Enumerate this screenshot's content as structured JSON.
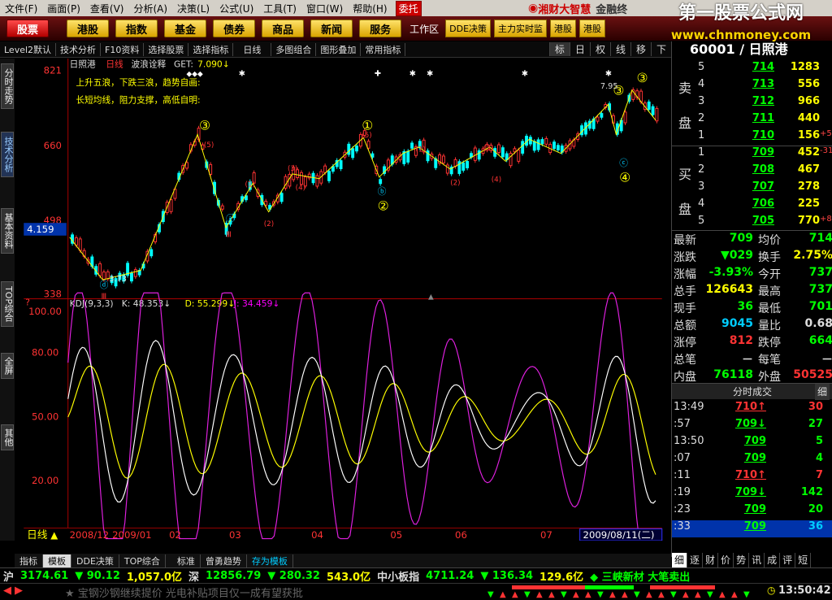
{
  "menu": [
    "文件(F)",
    "画面(P)",
    "查看(V)",
    "分析(A)",
    "决策(L)",
    "公式(U)",
    "工具(T)",
    "窗口(W)",
    "帮助(H)"
  ],
  "menu_red": "委托",
  "logo": {
    "brand": "湘财大智慧",
    "sub": "金融终"
  },
  "watermark": {
    "line1": "第一股票公式网",
    "line2": "www.chnmoney.com"
  },
  "nav": {
    "buttons": [
      "股票",
      "港股",
      "指数",
      "基金",
      "债券",
      "商品",
      "新闻",
      "服务"
    ],
    "workarea": "工作区",
    "right": [
      "DDE决策",
      "主力实时监",
      "港股",
      "港股"
    ]
  },
  "toolbar": {
    "items": [
      "Level2默认",
      "技术分析",
      "F10资料",
      "选择股票",
      "选择指标",
      "日线",
      "多图组合",
      "图形叠加",
      "常用指标"
    ],
    "small": [
      "标",
      "日",
      "权",
      "线",
      "移",
      "下"
    ]
  },
  "sidetabs": [
    "分时走势",
    "技术分析",
    "基本资料",
    "TOP综合",
    "全屏",
    "其他"
  ],
  "chart": {
    "title": "日照港",
    "period": "日线",
    "indicator": "波浪诠释",
    "get_label": "GET:",
    "get_value": "7.090↓",
    "notes": [
      "上升五浪，下跌三浪，趋势自画:",
      "长短均线，阻力支撑，高低自明:"
    ],
    "price_labels": [
      "821",
      "660",
      "498",
      "338"
    ],
    "current_price": "4.159",
    "low_label": "3.73",
    "high_label": "7.95",
    "kdj_header": "KDJ(9,3,3)",
    "kdj_k": "K: 48.353↓",
    "kdj_d": "D: 55.299↓",
    "kdj_j": "J: 34.459↓",
    "kdj_labels": [
      "100.00",
      "80.00",
      "50.00",
      "20.00"
    ],
    "dates": [
      "2008/12",
      "2009/01",
      "02",
      "03",
      "04",
      "05",
      "06",
      "07"
    ],
    "date_selected": "2009/08/11(二)",
    "period_label": "日线",
    "circle_marks": [
      "③",
      "①",
      "②",
      "③",
      "③",
      "④"
    ],
    "wave_marks": [
      "(1)",
      "(2)",
      "(3)",
      "(4)",
      "(5)",
      "(1)",
      "(2)",
      "(3)",
      "(4)",
      "(5)",
      "Ⅲ",
      "Ⅲ",
      "ⓐ",
      "ⓑ",
      "ⓒ",
      "ⓓ"
    ]
  },
  "chart_data": {
    "type": "line",
    "note": "KDJ oscillator and candlestick price panel",
    "kdj_range": [
      0,
      100
    ]
  },
  "quote": {
    "code": "60001",
    "name": "日照港",
    "header": "60001 / 日照港"
  },
  "orderbook": {
    "sell_label": "卖盘",
    "buy_label": "买盘",
    "sell": [
      {
        "lv": "5",
        "p": "714",
        "v": "1283",
        "c": ""
      },
      {
        "lv": "4",
        "p": "713",
        "v": "556",
        "c": ""
      },
      {
        "lv": "3",
        "p": "712",
        "v": "966",
        "c": ""
      },
      {
        "lv": "2",
        "p": "711",
        "v": "440",
        "c": ""
      },
      {
        "lv": "1",
        "p": "710",
        "v": "156",
        "c": "+5"
      }
    ],
    "buy": [
      {
        "lv": "1",
        "p": "709",
        "v": "452",
        "c": "-31"
      },
      {
        "lv": "2",
        "p": "708",
        "v": "467",
        "c": ""
      },
      {
        "lv": "3",
        "p": "707",
        "c": "",
        "v": "278"
      },
      {
        "lv": "4",
        "p": "706",
        "v": "225",
        "c": ""
      },
      {
        "lv": "5",
        "p": "705",
        "v": "770",
        "c": "+8"
      }
    ]
  },
  "stats": [
    {
      "k": "最新",
      "v": "709",
      "vc": "#0f0",
      "k2": "均价",
      "v2": "714",
      "v2c": "#0f0"
    },
    {
      "k": "涨跌",
      "v": "▼029",
      "vc": "#0f0",
      "k2": "换手",
      "v2": "2.75%",
      "v2c": "#ff0"
    },
    {
      "k": "涨幅",
      "v": "-3.93%",
      "vc": "#0f0",
      "k2": "今开",
      "v2": "737",
      "v2c": "#0f0"
    },
    {
      "k": "总手",
      "v": "126643",
      "vc": "#ff0",
      "k2": "最高",
      "v2": "737",
      "v2c": "#0f0"
    },
    {
      "k": "现手",
      "v": "36",
      "vc": "#0f0",
      "k2": "最低",
      "v2": "701",
      "v2c": "#0f0"
    },
    {
      "k": "总额",
      "v": "9045",
      "vc": "#0cf",
      "k2": "量比",
      "v2": "0.68",
      "v2c": "#ddd"
    },
    {
      "k": "涨停",
      "v": "812",
      "vc": "#f33",
      "k2": "跌停",
      "v2": "664",
      "v2c": "#0f0"
    },
    {
      "k": "总笔",
      "v": "－",
      "vc": "#ddd",
      "k2": "每笔",
      "v2": "－",
      "v2c": "#ddd"
    },
    {
      "k": "内盘",
      "v": "76118",
      "vc": "#0f0",
      "k2": "外盘",
      "v2": "50525",
      "v2c": "#f33"
    }
  ],
  "trades": {
    "header": "分时成交",
    "detail": "细",
    "rows": [
      {
        "t": "13:49",
        "p": "710↑",
        "v": "30",
        "vc": "#f33"
      },
      {
        "t": ":57",
        "p": "709↓",
        "v": "27",
        "vc": "#0f0"
      },
      {
        "t": "13:50",
        "p": "709",
        "v": "5",
        "vc": "#0f0"
      },
      {
        "t": ":07",
        "p": "709",
        "v": "4",
        "vc": "#0f0"
      },
      {
        "t": ":11",
        "p": "710↑",
        "v": "7",
        "vc": "#f33"
      },
      {
        "t": ":19",
        "p": "709↓",
        "v": "142",
        "vc": "#0f0"
      },
      {
        "t": ":23",
        "p": "709",
        "v": "20",
        "vc": "#0f0"
      },
      {
        "t": ":33",
        "p": "709",
        "v": "36",
        "vc": "#0cf"
      }
    ]
  },
  "rtabs": [
    "细",
    "逐",
    "财",
    "价",
    "势",
    "讯",
    "成",
    "评",
    "短"
  ],
  "btabs": [
    "指标",
    "模板",
    "DDE决策",
    "TOP综合",
    "标准",
    "曾勇趋势",
    "存为模板"
  ],
  "status": {
    "sh_label": "沪",
    "sh_val": "3174.61",
    "sh_chg": "▼ 90.12",
    "sh_amt": "1,057.0亿",
    "sz_label": "深",
    "sz_val": "12856.79",
    "sz_chg": "▼ 280.32",
    "sz_amt": "543.0亿",
    "sm_label": "中小板指",
    "sm_val": "4711.24",
    "sm_chg": "▼ 136.34",
    "sm_amt": "129.6亿",
    "news": "◆ 三峡新材  大笔卖出"
  },
  "ticker": {
    "text": "★ 宝钢沙钢继续提价 光电补贴项目仅一成有望获批",
    "time": "13:50:42"
  }
}
